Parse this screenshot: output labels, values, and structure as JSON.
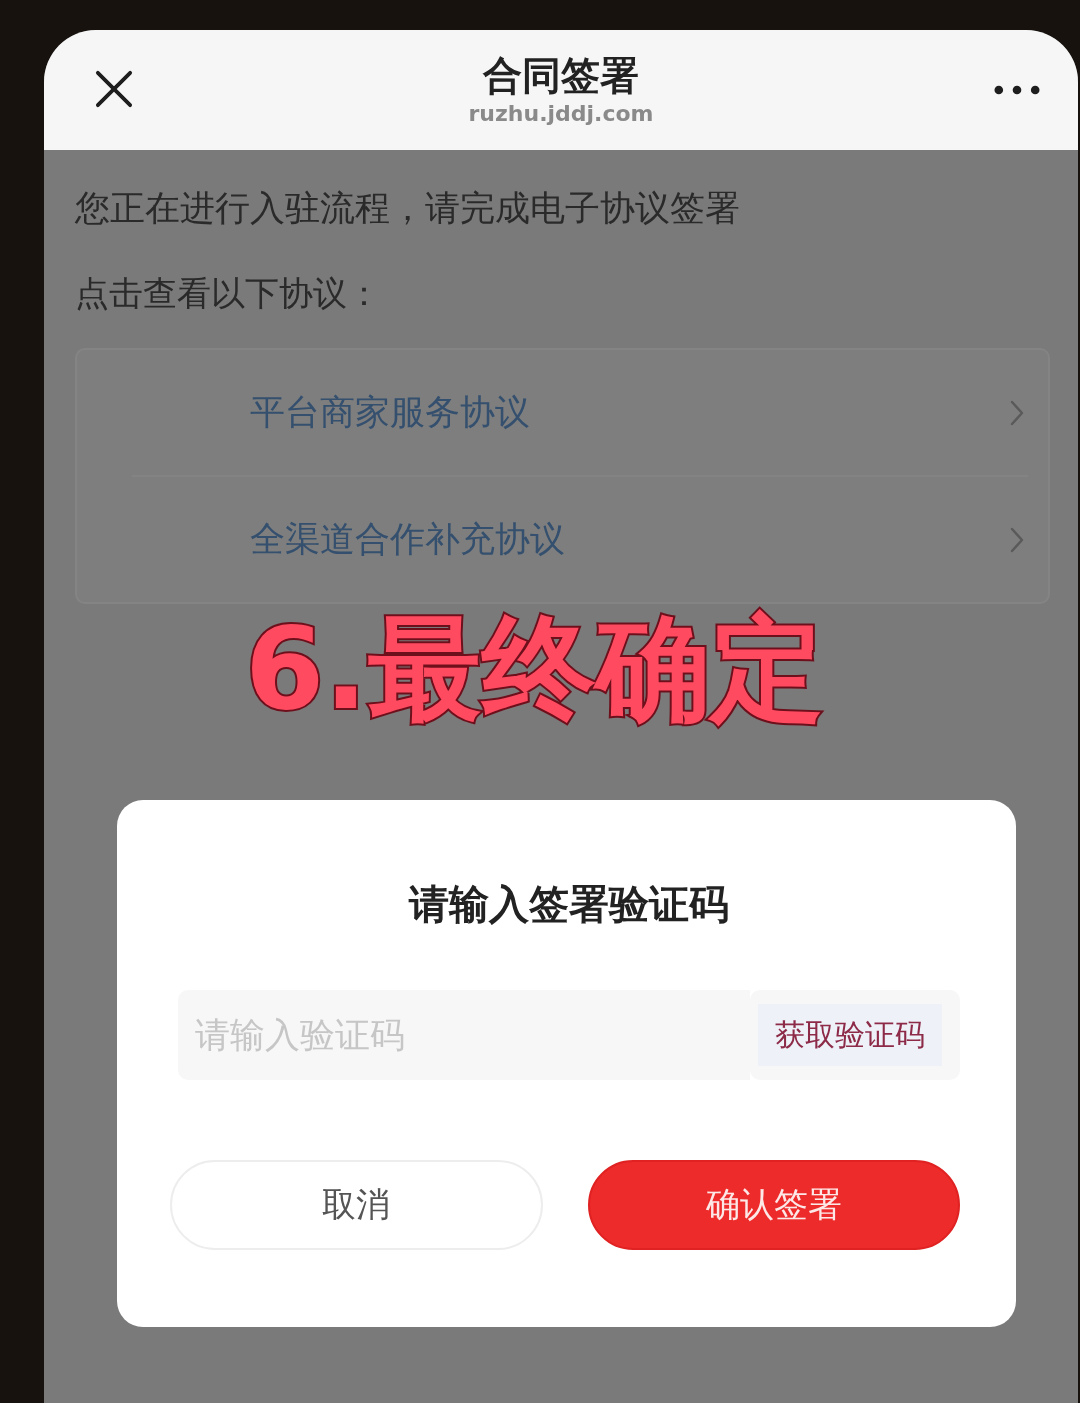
{
  "header": {
    "title": "合同签署",
    "url": "ruzhu.jddj.com"
  },
  "intro": "您正在进行入驻流程，请完成电子协议签署",
  "section_label": "点击查看以下协议：",
  "agreements": [
    {
      "title": "平台商家服务协议"
    },
    {
      "title": "全渠道合作补充协议"
    }
  ],
  "annotation": "6.最终确定",
  "dialog": {
    "title": "请输入签署验证码",
    "input": {
      "placeholder": "请输入验证码"
    },
    "get_code_button": "获取验证码",
    "buttons": [
      {
        "label": "取消",
        "kind": "secondary"
      },
      {
        "label": "确认签署",
        "kind": "primary"
      }
    ]
  }
}
